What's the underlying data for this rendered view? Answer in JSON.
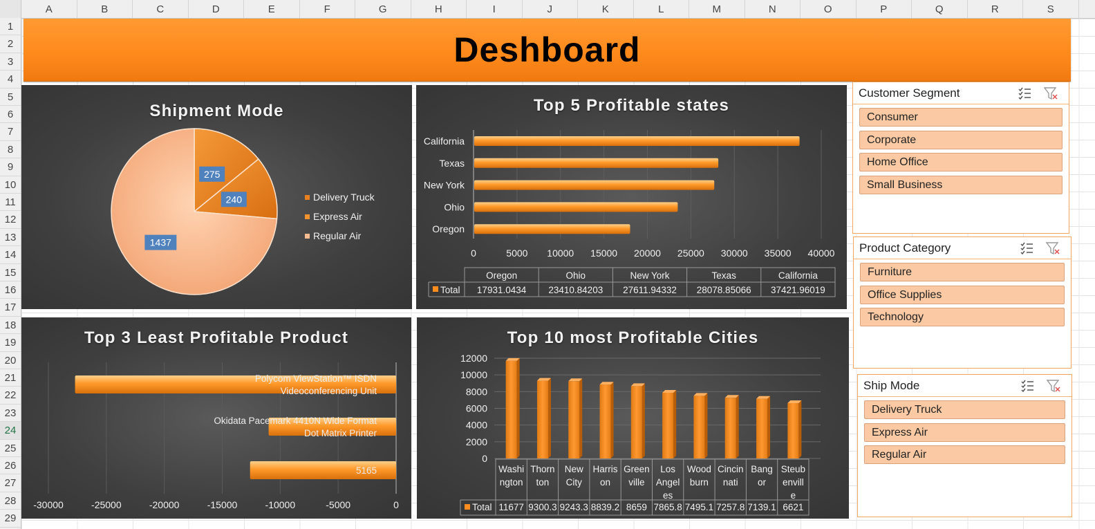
{
  "sheet": {
    "columns": [
      "A",
      "B",
      "C",
      "D",
      "E",
      "F",
      "G",
      "H",
      "I",
      "J",
      "K",
      "L",
      "M",
      "N",
      "O",
      "P",
      "Q",
      "R",
      "S"
    ],
    "rows": [
      "1",
      "2",
      "3",
      "4",
      "5",
      "6",
      "7",
      "8",
      "9",
      "10",
      "11",
      "12",
      "13",
      "14",
      "15",
      "16",
      "17",
      "18",
      "19",
      "20",
      "21",
      "22",
      "23",
      "24",
      "25",
      "26",
      "27",
      "28",
      "29"
    ],
    "selected_row": "24"
  },
  "banner": {
    "title": "Deshboard"
  },
  "accent_colors": {
    "orange": "#ff8c1f",
    "light_orange": "#f9b98a",
    "slicer_item": "#fbc9a3"
  },
  "shipment": {
    "title": "Shipment Mode",
    "legend": [
      "Delivery Truck",
      "Express Air",
      "Regular Air"
    ]
  },
  "states": {
    "title": "Top 5 Profitable states",
    "total_label": "Total"
  },
  "least": {
    "title": "Top 3 Least Profitable Product"
  },
  "cities": {
    "title": "Top 10 most Profitable Cities",
    "total_label": "Total"
  },
  "chart_data": [
    {
      "type": "pie",
      "title": "Shipment Mode",
      "categories": [
        "Delivery Truck",
        "Express Air",
        "Regular Air"
      ],
      "values": [
        275,
        240,
        1437
      ],
      "data_labels": [
        "275",
        "240",
        "1437"
      ],
      "colors": [
        "#e8801f",
        "#f0922e",
        "#f9bb90"
      ],
      "legend": "right"
    },
    {
      "type": "bar",
      "orientation": "horizontal",
      "title": "Top 5 Profitable states",
      "categories": [
        "California",
        "Texas",
        "New York",
        "Ohio",
        "Oregon"
      ],
      "values": [
        37421.96019,
        28078.85066,
        27611.94332,
        23410.84203,
        17931.0434
      ],
      "xlim": [
        0,
        40000
      ],
      "xticks": [
        "0",
        "5000",
        "10000",
        "15000",
        "20000",
        "25000",
        "30000",
        "35000",
        "40000"
      ],
      "grid": true,
      "data_table": {
        "headers": [
          "Oregon",
          "Ohio",
          "New York",
          "Texas",
          "California"
        ],
        "row_label": "Total",
        "cells": [
          "17931.0434",
          "23410.84203",
          "27611.94332",
          "28078.85066",
          "37421.96019"
        ]
      }
    },
    {
      "type": "bar",
      "orientation": "horizontal",
      "title": "Top 3 Least Profitable Product",
      "categories": [
        "Polycom ViewStation™ ISDN Videoconferencing Unit",
        "Okidata Pacemark 4410N Wide Format Dot Matrix Printer",
        ""
      ],
      "category_lines": [
        [
          "Polycom ViewStation™ ISDN",
          "Videoconferencing Unit"
        ],
        [
          "Okidata Pacemark 4410N Wide Format",
          "Dot Matrix Printer"
        ],
        [
          "5165"
        ]
      ],
      "values": [
        -27700,
        -11000,
        -12600
      ],
      "xlim": [
        -30000,
        0
      ],
      "xticks": [
        "-30000",
        "-25000",
        "-20000",
        "-15000",
        "-10000",
        "-5000",
        "0"
      ],
      "grid": true
    },
    {
      "type": "bar",
      "title": "Top 10 most Profitable Cities",
      "categories": [
        "Washington",
        "Thornton",
        "New City",
        "Harrison",
        "Greenville",
        "Los Angeles",
        "Woodburn",
        "Cincinnati",
        "Bangor",
        "Steubenville"
      ],
      "category_lines": [
        [
          "Washi",
          "ngton"
        ],
        [
          "Thorn",
          "ton"
        ],
        [
          "New",
          "City"
        ],
        [
          "Harris",
          "on"
        ],
        [
          "Green",
          "ville"
        ],
        [
          "Los",
          "Angel",
          "es"
        ],
        [
          "Wood",
          "burn"
        ],
        [
          "Cincin",
          "nati"
        ],
        [
          "Bang",
          "or"
        ],
        [
          "Steub",
          "envill",
          "e"
        ]
      ],
      "values": [
        11677,
        9300.3,
        9243.3,
        8839.2,
        8659,
        7865.8,
        7495.1,
        7257.8,
        7139.1,
        6621
      ],
      "ylim": [
        0,
        12000
      ],
      "yticks": [
        "0",
        "2000",
        "4000",
        "6000",
        "8000",
        "10000",
        "12000"
      ],
      "grid": true,
      "data_table": {
        "row_label": "Total",
        "cells": [
          "11677",
          "9300.3",
          "9243.3",
          "8839.2",
          "8659",
          "7865.8",
          "7495.1",
          "7257.8",
          "7139.1",
          "6621"
        ]
      }
    }
  ],
  "slicers": [
    {
      "title": "Customer Segment",
      "items": [
        "Consumer",
        "Corporate",
        "Home Office",
        "Small Business"
      ]
    },
    {
      "title": "Product Category",
      "items": [
        "Furniture",
        "Office Supplies",
        "Technology"
      ]
    },
    {
      "title": "Ship Mode",
      "items": [
        "Delivery Truck",
        "Express Air",
        "Regular Air"
      ]
    }
  ],
  "slicer_icons": [
    "multi-select-icon",
    "clear-filter-icon"
  ]
}
